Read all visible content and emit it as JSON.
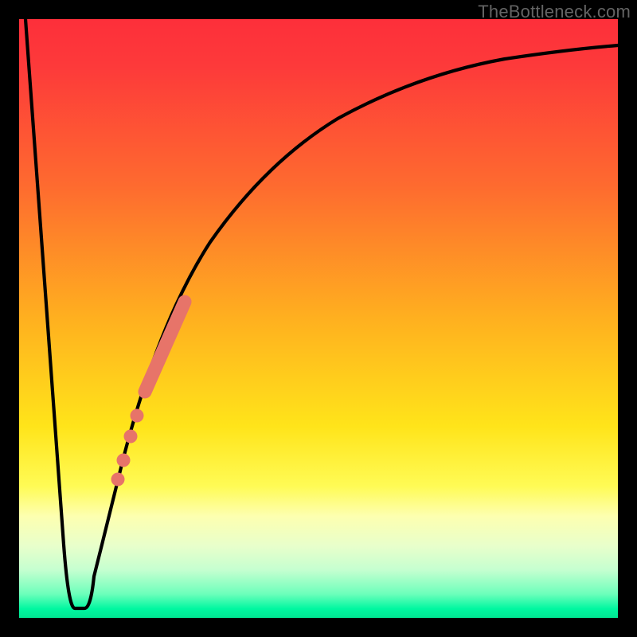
{
  "attribution": "TheBottleneck.com",
  "colors": {
    "frame": "#000000",
    "gradient_top": "#fd2f3a",
    "gradient_mid": "#ffe41a",
    "gradient_bottom": "#00e692",
    "curve": "#000000",
    "marker": "#e77469"
  },
  "chart_data": {
    "type": "line",
    "title": "",
    "xlabel": "",
    "ylabel": "",
    "xlim": [
      0,
      100
    ],
    "ylim": [
      0,
      100
    ],
    "x": [
      0,
      4,
      8,
      9,
      10,
      11,
      12.5,
      13.5,
      15,
      18,
      22,
      26,
      30,
      35,
      40,
      46,
      55,
      65,
      78,
      90,
      100
    ],
    "values": [
      100,
      70,
      12,
      3,
      2,
      2,
      3,
      8,
      14,
      25,
      38,
      48,
      56,
      64,
      70,
      76,
      82,
      86.5,
      90.4,
      92.5,
      93.6
    ],
    "series": [
      {
        "name": "curve",
        "x": [
          0,
          4,
          8,
          9,
          10,
          11,
          12.5,
          13.5,
          15,
          18,
          22,
          26,
          30,
          35,
          40,
          46,
          55,
          65,
          78,
          90,
          100
        ],
        "y": [
          100,
          70,
          12,
          3,
          2,
          2,
          3,
          8,
          14,
          25,
          38,
          48,
          56,
          64,
          70,
          76,
          82,
          86.5,
          90.4,
          92.5,
          93.6
        ]
      }
    ],
    "markers": [
      {
        "type": "thick_segment",
        "x_range": [
          22,
          28
        ],
        "y_range": [
          38,
          52
        ]
      },
      {
        "type": "dot",
        "x": 20.5,
        "y": 33
      },
      {
        "type": "dot",
        "x": 19.5,
        "y": 29.5
      },
      {
        "type": "dot",
        "x": 18.2,
        "y": 25.5
      },
      {
        "type": "dot",
        "x": 17.3,
        "y": 22.4
      }
    ]
  }
}
